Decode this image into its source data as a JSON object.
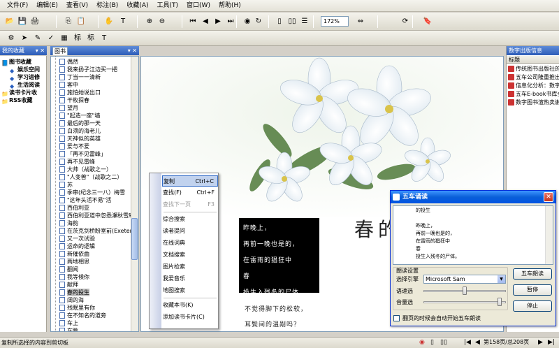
{
  "menu": [
    "文件(F)",
    "编辑(E)",
    "查看(V)",
    "标注(B)",
    "收藏(A)",
    "工具(T)",
    "窗口(W)",
    "帮助(H)"
  ],
  "toolbar": {
    "zoom": "172%",
    "icons": [
      "open-icon",
      "save-icon",
      "print-icon",
      "copy-icon",
      "paste-icon",
      "hand-icon",
      "text-select-icon",
      "zoom-in-icon",
      "zoom-out-icon",
      "first-page-icon",
      "prev-page-icon",
      "next-page-icon",
      "last-page-icon",
      "back-icon",
      "forward-icon",
      "page-icon",
      "two-page-icon",
      "continuous-icon",
      "fit-width-icon",
      "rotate-icon",
      "bookmark-icon"
    ]
  },
  "favorites": {
    "title": "我的收藏",
    "items": [
      {
        "label": "图书收藏",
        "level": 0,
        "icon": "book-icon"
      },
      {
        "label": "娱乐空间",
        "level": 1,
        "icon": "diamond-icon"
      },
      {
        "label": "学习进修",
        "level": 1,
        "icon": "diamond-icon"
      },
      {
        "label": "生活阅读",
        "level": 1,
        "icon": "diamond-icon"
      },
      {
        "label": "读书卡片收",
        "level": 0,
        "icon": "folder-icon"
      },
      {
        "label": "RSS收藏",
        "level": 0,
        "icon": "folder-icon"
      }
    ]
  },
  "booklist": {
    "tab": "图书",
    "items": [
      "偶然",
      "我来扬子江边买一把",
      "丁当一一清新",
      "客中",
      "施怕她说出口",
      "干枚探春",
      "望月",
      "\"起造一座\"墙",
      "最后的那一天",
      "白须的海老儿",
      "天神似的英雄",
      "爱与不爱",
      "「再不见雷峰」",
      "再不见雷峰",
      "大帅（战歌之一）",
      "\"人变兽\"（战歌之二）",
      "苏",
      "季审(纪念三一八）梅雪",
      "\"这年头活不易\"活",
      "西伯利亚",
      "西伯利亚道中忽悉瀬秋雪庵",
      "海韵",
      "在茨克剑桥盼室前(Exeter)",
      "又一次试验",
      "运命的逻辑",
      "新催依曲",
      "两地相思",
      "翻闻",
      "我等候你",
      "献拜",
      "春的投生",
      "阔的海",
      "残眠里有你",
      "在不知名的道旁",
      "车上",
      "车眺"
    ],
    "selected": "春的投生"
  },
  "document": {
    "title": "春的投生",
    "poem": [
      "昨晚上，",
      "再前一晚也是的，",
      "在雷雨的猖狂中",
      "春",
      "投生入残冬的尸体。"
    ],
    "tail": [
      "不觉得脚下的松软，",
      "耳鬓间的温剐吗？"
    ]
  },
  "context_menu": {
    "items": [
      {
        "label": "复制",
        "shortcut": "Ctrl+C",
        "state": "highlight"
      },
      {
        "label": "查找(F)",
        "shortcut": "Ctrl+F",
        "state": "normal"
      },
      {
        "label": "查找下一页",
        "shortcut": "F3",
        "state": "disabled"
      },
      {
        "label": "综合搜索",
        "shortcut": "",
        "state": "normal"
      },
      {
        "label": "读者提问",
        "shortcut": "",
        "state": "normal"
      },
      {
        "label": "在线词典",
        "shortcut": "",
        "state": "normal"
      },
      {
        "label": "文档搜索",
        "shortcut": "",
        "state": "normal"
      },
      {
        "label": "图片检索",
        "shortcut": "",
        "state": "normal"
      },
      {
        "label": "我爱音乐",
        "shortcut": "",
        "state": "normal"
      },
      {
        "label": "地图搜索",
        "shortcut": "",
        "state": "normal"
      },
      {
        "label": "收藏本书(K)",
        "shortcut": "",
        "state": "normal"
      },
      {
        "label": "添加读书卡片(C)",
        "shortcut": "",
        "state": "normal"
      }
    ]
  },
  "right_panel": {
    "title": "数字出版信息",
    "column": "标题",
    "items": [
      "传统图书出版社的",
      "五车公司隆重推出",
      "信息化分析：数字",
      "五车E-book书库全",
      "数字图书渲热卖谢"
    ]
  },
  "dialog": {
    "title": "五车诵读",
    "text": [
      "的投生",
      "",
      "昨晚上，",
      "再前一晚也是的，",
      "在雷雨的猖狂中",
      "春",
      "投生入残冬的尸体。"
    ],
    "settings_label": "朗读设置",
    "engine_label": "选择引擎",
    "engine_value": "Microsoft Sam",
    "speed_label": "语速选",
    "volume_label": "音量选",
    "speed": 0.5,
    "volume": 0.95,
    "read_button": "五车朗读",
    "pause_button": "暂停",
    "stop_button": "停止",
    "auto_read_label": "翻页的时候会自动开始五车朗读",
    "auto_read_checked": false
  },
  "status": {
    "text": "复制所选择的内容到剪切板",
    "page": "第158页/总208页"
  }
}
